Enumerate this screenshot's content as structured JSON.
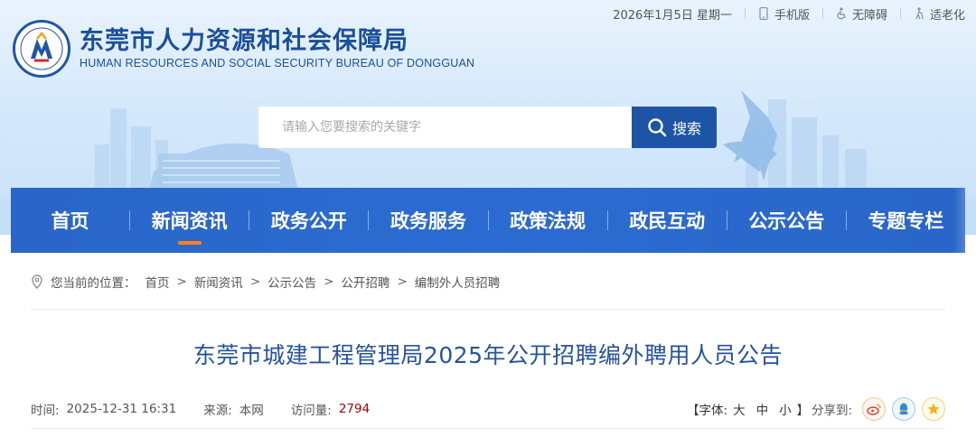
{
  "header": {
    "site_name_cn": "东莞市人力资源和社会保障局",
    "site_name_en": "HUMAN RESOURCES AND SOCIAL SECURITY BUREAU OF DONGGUAN",
    "date": "2026年1月5日 星期一",
    "links": [
      {
        "label": "手机版",
        "icon": "mobile-icon"
      },
      {
        "label": "无障碍",
        "icon": "accessibility-icon"
      },
      {
        "label": "适老化",
        "icon": "elderly-icon"
      }
    ]
  },
  "search": {
    "placeholder": "请输入您要搜索的关键字",
    "button_label": "搜索"
  },
  "nav": {
    "items": [
      "首页",
      "新闻资讯",
      "政务公开",
      "政务服务",
      "政策法规",
      "政民互动",
      "公示公告",
      "专题专栏"
    ],
    "active_index": 1
  },
  "breadcrumb": {
    "prefix": "您当前的位置：",
    "items": [
      "首页",
      "新闻资讯",
      "公示公告",
      "公开招聘",
      "编制外人员招聘"
    ],
    "separator": ">"
  },
  "article": {
    "title": "东莞市城建工程管理局2025年公开招聘编外聘用人员公告",
    "time_label": "时间:",
    "time_value": "2025-12-31 16:31",
    "source_label": "来源:",
    "source_value": "本网",
    "views_label": "访问量:",
    "views_value": "2794",
    "font_label": "【字体:",
    "font_options": [
      "大",
      "中",
      "小"
    ],
    "font_close": "】",
    "share_label": "分享到:"
  },
  "colors": {
    "nav_bg": "#2a66c9",
    "search_btn": "#1d54a6",
    "title": "#25549c",
    "active_underline": "#ff7e21",
    "views": "#b30000"
  }
}
